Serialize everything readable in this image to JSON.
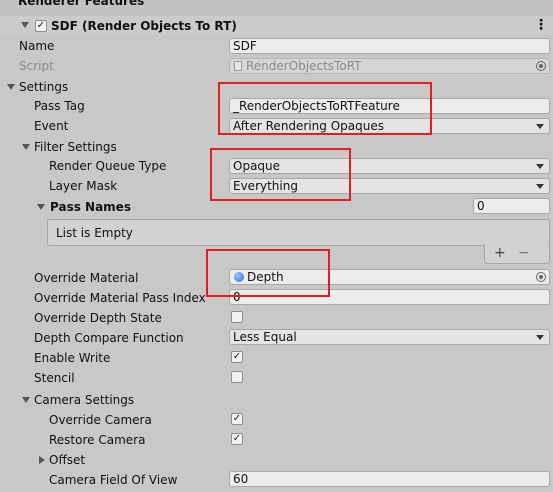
{
  "section_header": "Renderer Features",
  "feature": {
    "title": "SDF (Render Objects To RT)",
    "enabled": true
  },
  "fields": {
    "name_label": "Name",
    "name_value": "SDF",
    "script_label": "Script",
    "script_value": "RenderObjectsToRT",
    "settings_label": "Settings",
    "pass_tag_label": "Pass Tag",
    "pass_tag_value": "_RenderObjectsToRTFeature",
    "event_label": "Event",
    "event_value": "After Rendering Opaques",
    "filter_settings_label": "Filter Settings",
    "render_queue_label": "Render Queue Type",
    "render_queue_value": "Opaque",
    "layer_mask_label": "Layer Mask",
    "layer_mask_value": "Everything",
    "pass_names_label": "Pass Names",
    "pass_names_count": "0",
    "list_empty": "List is Empty",
    "plus": "+",
    "minus": "−",
    "override_material_label": "Override Material",
    "override_material_value": "Depth",
    "override_pass_index_label": "Override Material Pass Index",
    "override_pass_index_value": "0",
    "override_depth_state_label": "Override Depth State",
    "depth_compare_label": "Depth Compare Function",
    "depth_compare_value": "Less Equal",
    "enable_write_label": "Enable Write",
    "stencil_label": "Stencil",
    "camera_settings_label": "Camera Settings",
    "override_camera_label": "Override Camera",
    "restore_camera_label": "Restore Camera",
    "offset_label": "Offset",
    "camera_fov_label": "Camera Field Of View",
    "camera_fov_value": "60",
    "check_mark": "✓"
  },
  "checks": {
    "override_depth_state": false,
    "enable_write": true,
    "stencil": false,
    "override_camera": true,
    "restore_camera": true
  },
  "icons": {
    "menu": "⋮"
  },
  "colors": {
    "highlight_box": "#e21f1f",
    "material_icon": "#2f6fd6"
  }
}
